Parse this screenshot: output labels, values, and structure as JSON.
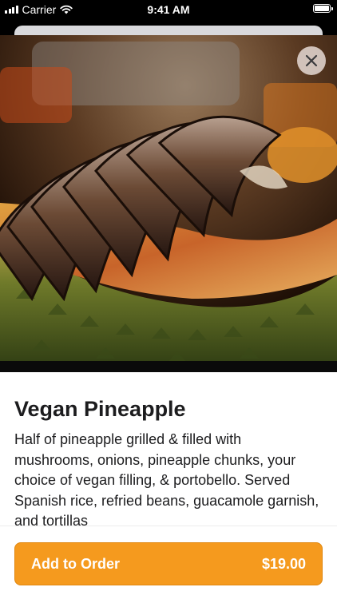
{
  "status_bar": {
    "carrier": "Carrier",
    "time": "9:41 AM"
  },
  "item": {
    "title": "Vegan Pineapple",
    "description": "Half of pineapple grilled & filled with mushrooms, onions, pineapple chunks, your choice of vegan filling, & portobello. Served Spanish rice, refried beans, guacamole garnish, and tortillas"
  },
  "order_button": {
    "label": "Add to Order",
    "price": "$19.00"
  },
  "icons": {
    "close": "close-icon",
    "signal": "cellular-signal-icon",
    "wifi": "wifi-icon",
    "battery": "battery-icon"
  },
  "colors": {
    "accent": "#f59a1e",
    "text": "#1c1c1e"
  }
}
